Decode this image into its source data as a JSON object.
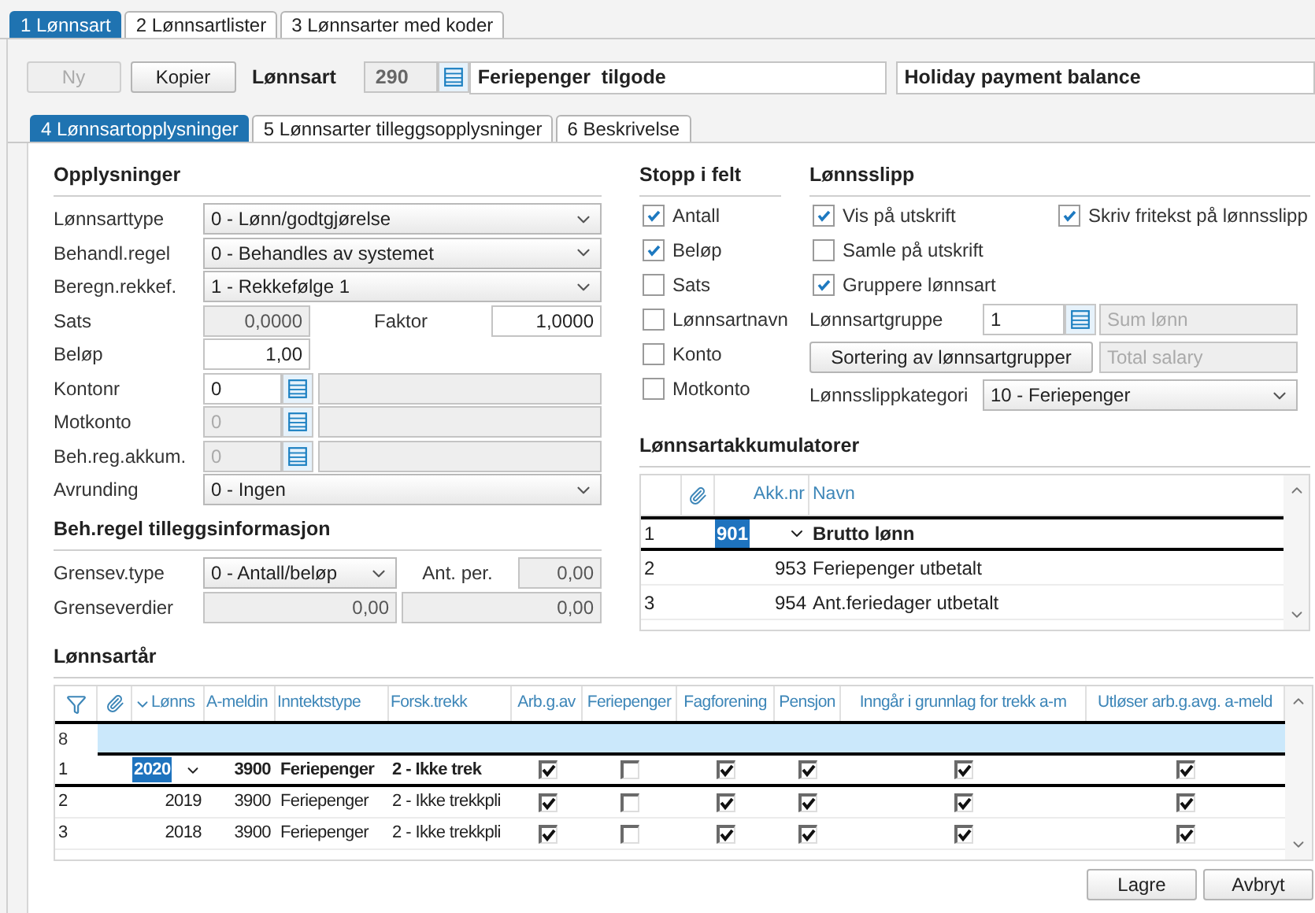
{
  "main_tabs": [
    {
      "label": "1 Lønnsart",
      "selected": true
    },
    {
      "label": "2 Lønnsartlister",
      "selected": false
    },
    {
      "label": "3 Lønnsarter med koder",
      "selected": false
    }
  ],
  "toolbar": {
    "new_button": {
      "label": "Ny",
      "disabled": true
    },
    "copy_button": {
      "label": "Kopier",
      "disabled": false
    },
    "label": "Lønnsart",
    "number": "290",
    "name": "Feriepenger  tilgode",
    "english_name": "Holiday payment balance"
  },
  "sub_tabs": [
    {
      "label": "4 Lønnsartopplysninger",
      "selected": true
    },
    {
      "label": "5 Lønnsarter tilleggsopplysninger",
      "selected": false
    },
    {
      "label": "6 Beskrivelse",
      "selected": false
    }
  ],
  "opplysninger": {
    "title": "Opplysninger",
    "rows": [
      {
        "kind": "select",
        "label": "Lønnsarttype",
        "value": "0 - Lønn/godtgjørelse"
      },
      {
        "kind": "select",
        "label": "Behandl.regel",
        "value": "0 - Behandles av systemet"
      },
      {
        "kind": "select",
        "label": "Beregn.rekkef.",
        "value": "1 - Rekkefølge 1"
      },
      {
        "kind": "pair",
        "label": "Sats",
        "value": "0,0000",
        "disabled": true,
        "label2": "Faktor",
        "value2": "1,0000"
      },
      {
        "kind": "number",
        "label": "Beløp",
        "value": "1,00",
        "disabled": false
      },
      {
        "kind": "lookup",
        "label": "Kontonr",
        "value": "0",
        "disabled": false
      },
      {
        "kind": "lookup",
        "label": "Motkonto",
        "value": "0",
        "disabled": true
      },
      {
        "kind": "lookup",
        "label": "Beh.reg.akkum.",
        "value": "0",
        "disabled": true
      },
      {
        "kind": "select",
        "label": "Avrunding",
        "value": "0 - Ingen"
      }
    ]
  },
  "tillegg": {
    "title": "Beh.regel tilleggsinformasjon",
    "type_label": "Grensev.type",
    "type_value": "0 - Antall/beløp",
    "per_label": "Ant. per.",
    "per_value": "0,00",
    "limits_label": "Grenseverdier",
    "limits": [
      "0,00",
      "0,00"
    ]
  },
  "stopp": {
    "title": "Stopp i felt",
    "items": [
      {
        "label": "Antall",
        "checked": true
      },
      {
        "label": "Beløp",
        "checked": true
      },
      {
        "label": "Sats",
        "checked": false
      },
      {
        "label": "Lønnsartnavn",
        "checked": false
      },
      {
        "label": "Konto",
        "checked": false
      },
      {
        "label": "Motkonto",
        "checked": false
      }
    ]
  },
  "lonnsslipp": {
    "title": "Lønnsslipp",
    "checks": [
      {
        "label": "Vis på utskrift",
        "checked": true
      },
      {
        "label": "Samle på utskrift",
        "checked": false
      },
      {
        "label": "Gruppere lønnsart",
        "checked": true
      }
    ],
    "extra_check": {
      "label": "Skriv fritekst på lønnsslipp",
      "checked": true
    },
    "group_label": "Lønnsartgruppe",
    "group_value": "1",
    "group_name": "Sum lønn",
    "sort_button": "Sortering av lønnsartgrupper",
    "english_name": "Total salary",
    "category_label": "Lønnsslippkategori",
    "category_value": "10 - Feriepenger"
  },
  "akkumulatorer": {
    "title": "Lønnsartakkumulatorer",
    "columns": [
      "Akk.nr",
      "Navn"
    ],
    "rows": [
      {
        "index": "1",
        "number": "901",
        "name": "Brutto lønn",
        "selected": true
      },
      {
        "index": "2",
        "number": "953",
        "name": "Feriepenger utbetalt",
        "selected": false
      },
      {
        "index": "3",
        "number": "954",
        "name": "Ant.feriedager utbetalt",
        "selected": false
      }
    ]
  },
  "lonnsartar": {
    "title": "Lønnsartår",
    "columns": [
      "Lønns",
      "A-meldin",
      "Inntektstype",
      "Forsk.trekk",
      "Arb.g.av",
      "Feriepenger",
      "Fagforening",
      "Pensjon",
      "Inngår i grunnlag for trekk a-m",
      "Utløser arb.g.avg. a-meld"
    ],
    "new_row": "8",
    "rows": [
      {
        "index": "1",
        "year": "2020",
        "code": "3900",
        "type": "Feriepenger",
        "trekk": "2 - Ikke trek",
        "checks": [
          true,
          false,
          true,
          true,
          true,
          true
        ],
        "selected": true
      },
      {
        "index": "2",
        "year": "2019",
        "code": "3900",
        "type": "Feriepenger",
        "trekk": "2 - Ikke trekkpli",
        "checks": [
          true,
          false,
          true,
          true,
          true,
          true
        ],
        "selected": false
      },
      {
        "index": "3",
        "year": "2018",
        "code": "3900",
        "type": "Feriepenger",
        "trekk": "2 - Ikke trekkpli",
        "checks": [
          true,
          false,
          true,
          true,
          true,
          true
        ],
        "selected": false
      }
    ]
  },
  "buttons": [
    "Lagre",
    "Avbryt"
  ]
}
